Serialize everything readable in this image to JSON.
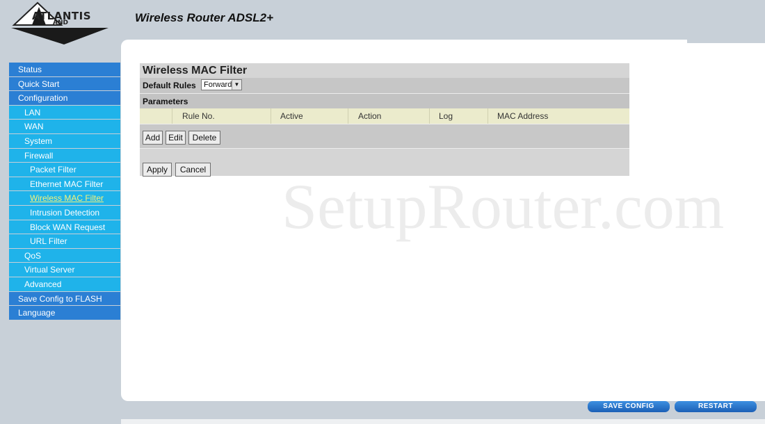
{
  "header": {
    "brand": "ATLANTIS",
    "brand_sub": "AND",
    "title": "Wireless Router ADSL2+"
  },
  "sidebar": {
    "items": [
      {
        "label": "Status"
      },
      {
        "label": "Quick Start"
      },
      {
        "label": "Configuration"
      },
      {
        "label": "LAN"
      },
      {
        "label": "WAN"
      },
      {
        "label": "System"
      },
      {
        "label": "Firewall"
      },
      {
        "label": "Packet Filter"
      },
      {
        "label": "Ethernet MAC Filter"
      },
      {
        "label": "Wireless MAC Filter"
      },
      {
        "label": "Intrusion Detection"
      },
      {
        "label": "Block WAN Request"
      },
      {
        "label": "URL Filter"
      },
      {
        "label": "QoS"
      },
      {
        "label": "Virtual Server"
      },
      {
        "label": "Advanced"
      },
      {
        "label": "Save Config to FLASH"
      },
      {
        "label": "Language"
      }
    ],
    "active": "Wireless MAC Filter"
  },
  "main": {
    "title": "Wireless MAC Filter",
    "default_rules_label": "Default Rules",
    "default_rules_value": "Forward",
    "parameters_label": "Parameters",
    "columns": [
      "Rule No.",
      "Active",
      "Action",
      "Log",
      "MAC Address"
    ],
    "buttons": {
      "add": "Add",
      "edit": "Edit",
      "delete": "Delete",
      "apply": "Apply",
      "cancel": "Cancel"
    }
  },
  "footer": {
    "save_config": "SAVE CONFIG",
    "restart": "RESTART"
  },
  "watermark": "SetupRouter.com",
  "colors": {
    "nav_primary": "#2b7fd4",
    "nav_secondary": "#1fb3ea",
    "active_link": "#f4f27a",
    "page_bg": "#c8d0d8"
  }
}
